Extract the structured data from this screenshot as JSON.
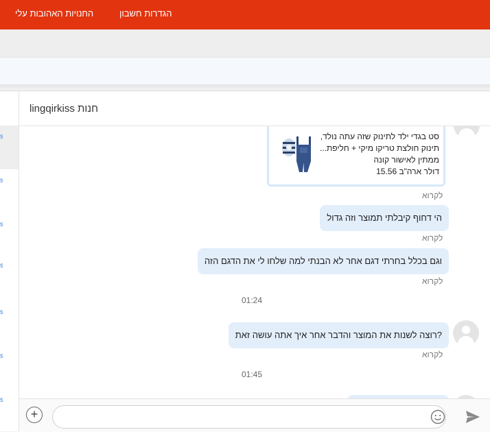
{
  "topbar": {
    "nav_favorites": "החנויות האהובות עלי",
    "nav_account": "הגדרות חשבון"
  },
  "chat": {
    "title": "חנות lingqirkiss"
  },
  "product_card": {
    "line1": "סט בגדי ילד לתינוק שזה עתה נולד,",
    "line2": "תינוק חולצת טריקו מיקי + חליפת...",
    "line3": "ממתין לאישור קונה",
    "line4": "דולר ארה\"ב 15.56"
  },
  "messages": {
    "read_label": "לקרוא",
    "msg1": "הי דחוף קיבלתי תמוצר וזה גדול",
    "msg2": "וגם בכלל בחרתי דגם אחר לא הבנתי למה שלחו לי את הדגם הזה",
    "time1": "01:24",
    "msg3": "?רוצה לשנות את המוצר והדבר אחר איך אתה עושה זאת",
    "time2": "01:45"
  },
  "composer": {
    "placeholder": "",
    "icons": [
      "plus-icon",
      "emoji-icon",
      "send-icon"
    ]
  },
  "colors": {
    "topbar": "#e2340f",
    "bubble": "#e3eefb",
    "card_border": "#d7e8fa"
  }
}
